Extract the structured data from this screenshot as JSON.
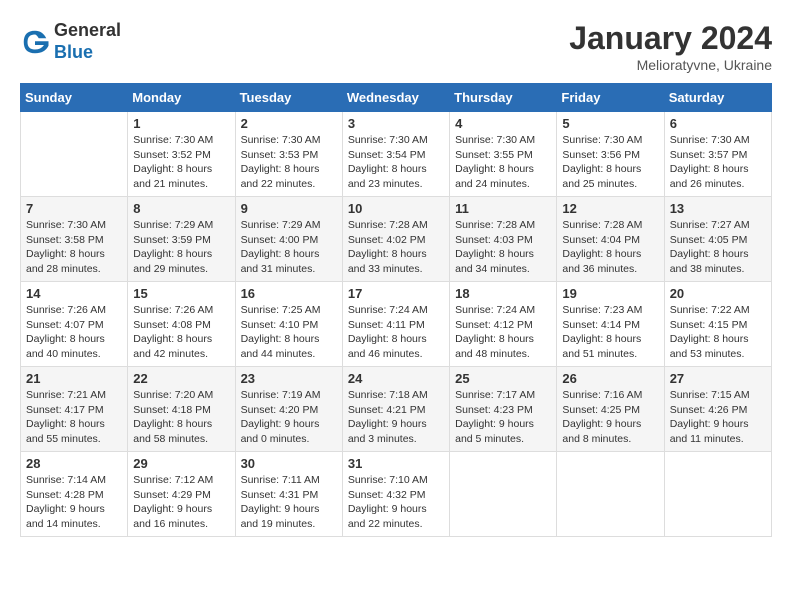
{
  "header": {
    "logo_general": "General",
    "logo_blue": "Blue",
    "month_year": "January 2024",
    "location": "Melioratyvne, Ukraine"
  },
  "days_of_week": [
    "Sunday",
    "Monday",
    "Tuesday",
    "Wednesday",
    "Thursday",
    "Friday",
    "Saturday"
  ],
  "weeks": [
    [
      {
        "day": "",
        "info": ""
      },
      {
        "day": "1",
        "info": "Sunrise: 7:30 AM\nSunset: 3:52 PM\nDaylight: 8 hours\nand 21 minutes."
      },
      {
        "day": "2",
        "info": "Sunrise: 7:30 AM\nSunset: 3:53 PM\nDaylight: 8 hours\nand 22 minutes."
      },
      {
        "day": "3",
        "info": "Sunrise: 7:30 AM\nSunset: 3:54 PM\nDaylight: 8 hours\nand 23 minutes."
      },
      {
        "day": "4",
        "info": "Sunrise: 7:30 AM\nSunset: 3:55 PM\nDaylight: 8 hours\nand 24 minutes."
      },
      {
        "day": "5",
        "info": "Sunrise: 7:30 AM\nSunset: 3:56 PM\nDaylight: 8 hours\nand 25 minutes."
      },
      {
        "day": "6",
        "info": "Sunrise: 7:30 AM\nSunset: 3:57 PM\nDaylight: 8 hours\nand 26 minutes."
      }
    ],
    [
      {
        "day": "7",
        "info": "Sunrise: 7:30 AM\nSunset: 3:58 PM\nDaylight: 8 hours\nand 28 minutes."
      },
      {
        "day": "8",
        "info": "Sunrise: 7:29 AM\nSunset: 3:59 PM\nDaylight: 8 hours\nand 29 minutes."
      },
      {
        "day": "9",
        "info": "Sunrise: 7:29 AM\nSunset: 4:00 PM\nDaylight: 8 hours\nand 31 minutes."
      },
      {
        "day": "10",
        "info": "Sunrise: 7:28 AM\nSunset: 4:02 PM\nDaylight: 8 hours\nand 33 minutes."
      },
      {
        "day": "11",
        "info": "Sunrise: 7:28 AM\nSunset: 4:03 PM\nDaylight: 8 hours\nand 34 minutes."
      },
      {
        "day": "12",
        "info": "Sunrise: 7:28 AM\nSunset: 4:04 PM\nDaylight: 8 hours\nand 36 minutes."
      },
      {
        "day": "13",
        "info": "Sunrise: 7:27 AM\nSunset: 4:05 PM\nDaylight: 8 hours\nand 38 minutes."
      }
    ],
    [
      {
        "day": "14",
        "info": "Sunrise: 7:26 AM\nSunset: 4:07 PM\nDaylight: 8 hours\nand 40 minutes."
      },
      {
        "day": "15",
        "info": "Sunrise: 7:26 AM\nSunset: 4:08 PM\nDaylight: 8 hours\nand 42 minutes."
      },
      {
        "day": "16",
        "info": "Sunrise: 7:25 AM\nSunset: 4:10 PM\nDaylight: 8 hours\nand 44 minutes."
      },
      {
        "day": "17",
        "info": "Sunrise: 7:24 AM\nSunset: 4:11 PM\nDaylight: 8 hours\nand 46 minutes."
      },
      {
        "day": "18",
        "info": "Sunrise: 7:24 AM\nSunset: 4:12 PM\nDaylight: 8 hours\nand 48 minutes."
      },
      {
        "day": "19",
        "info": "Sunrise: 7:23 AM\nSunset: 4:14 PM\nDaylight: 8 hours\nand 51 minutes."
      },
      {
        "day": "20",
        "info": "Sunrise: 7:22 AM\nSunset: 4:15 PM\nDaylight: 8 hours\nand 53 minutes."
      }
    ],
    [
      {
        "day": "21",
        "info": "Sunrise: 7:21 AM\nSunset: 4:17 PM\nDaylight: 8 hours\nand 55 minutes."
      },
      {
        "day": "22",
        "info": "Sunrise: 7:20 AM\nSunset: 4:18 PM\nDaylight: 8 hours\nand 58 minutes."
      },
      {
        "day": "23",
        "info": "Sunrise: 7:19 AM\nSunset: 4:20 PM\nDaylight: 9 hours\nand 0 minutes."
      },
      {
        "day": "24",
        "info": "Sunrise: 7:18 AM\nSunset: 4:21 PM\nDaylight: 9 hours\nand 3 minutes."
      },
      {
        "day": "25",
        "info": "Sunrise: 7:17 AM\nSunset: 4:23 PM\nDaylight: 9 hours\nand 5 minutes."
      },
      {
        "day": "26",
        "info": "Sunrise: 7:16 AM\nSunset: 4:25 PM\nDaylight: 9 hours\nand 8 minutes."
      },
      {
        "day": "27",
        "info": "Sunrise: 7:15 AM\nSunset: 4:26 PM\nDaylight: 9 hours\nand 11 minutes."
      }
    ],
    [
      {
        "day": "28",
        "info": "Sunrise: 7:14 AM\nSunset: 4:28 PM\nDaylight: 9 hours\nand 14 minutes."
      },
      {
        "day": "29",
        "info": "Sunrise: 7:12 AM\nSunset: 4:29 PM\nDaylight: 9 hours\nand 16 minutes."
      },
      {
        "day": "30",
        "info": "Sunrise: 7:11 AM\nSunset: 4:31 PM\nDaylight: 9 hours\nand 19 minutes."
      },
      {
        "day": "31",
        "info": "Sunrise: 7:10 AM\nSunset: 4:32 PM\nDaylight: 9 hours\nand 22 minutes."
      },
      {
        "day": "",
        "info": ""
      },
      {
        "day": "",
        "info": ""
      },
      {
        "day": "",
        "info": ""
      }
    ]
  ]
}
